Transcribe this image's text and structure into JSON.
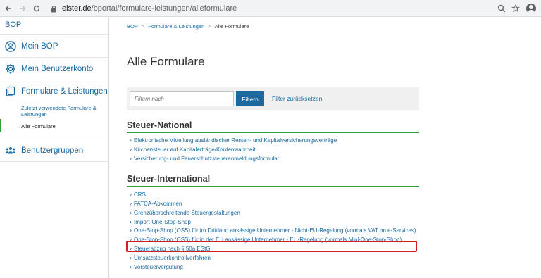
{
  "browser": {
    "url_domain": "elster.de",
    "url_path": "/bportal/formulare-leistungen/alleformulare",
    "icons": {
      "back": "arrow-left-icon",
      "forward": "arrow-right-icon",
      "reload": "reload-icon",
      "lock": "lock-icon",
      "zoom": "zoom-icon",
      "star": "star-icon",
      "account": "account-icon"
    }
  },
  "sidebar": {
    "brand": "BOP",
    "items": [
      {
        "label": "Mein BOP",
        "icon": "user-circle-icon"
      },
      {
        "label": "Mein Benutzerkonto",
        "icon": "gear-icon"
      },
      {
        "label": "Formulare & Leistungen",
        "icon": "documents-icon"
      },
      {
        "label": "Benutzergruppen",
        "icon": "user-group-icon"
      }
    ],
    "sub_items": [
      {
        "label": "Zuletzt verwendete Formulare & Leistungen"
      },
      {
        "label": "Alle Formulare"
      }
    ]
  },
  "breadcrumb": {
    "items": [
      "BOP",
      "Formulare & Leistungen",
      "Alle Formulare"
    ],
    "separator": ">"
  },
  "page": {
    "title": "Alle Formulare"
  },
  "filter": {
    "placeholder": "Filtern nach",
    "value": "",
    "button_label": "Filtern",
    "reset_label": "Filter zurücksetzen"
  },
  "sections": [
    {
      "title": "Steuer-National",
      "items": [
        "Elektronische Mitteilung ausländischer Renten- und Kapitalversicherungsverträge",
        "Kirchensteuer auf Kapitalerträge/Kontenwahrheit",
        "Versicherung- und Feuerschutzsteueranmeldungsformular"
      ]
    },
    {
      "title": "Steuer-International",
      "items": [
        "CRS",
        "FATCA-Abkommen",
        "Grenzüberschreitende Steuergestaltungen",
        "Import-One-Stop-Shop",
        "One-Stop-Shop (OSS) für im Drittland ansässige Unternehmer - Nicht-EU-Regelung (vormals VAT on e-Services)",
        "One-Stop-Shop (OSS) für in der EU ansässige Unternehmer - EU-Regelung (vormals Mini-One-Stop-Shop)",
        "Steuerabzug nach § 50a EStG",
        "Umsatzsteuerkontrollverfahren",
        "Vorsteuervergütung"
      ]
    }
  ],
  "colors": {
    "brand_blue": "#1a6aa1",
    "accent_green": "#2e9e3e",
    "highlight_red": "#d01e25"
  }
}
